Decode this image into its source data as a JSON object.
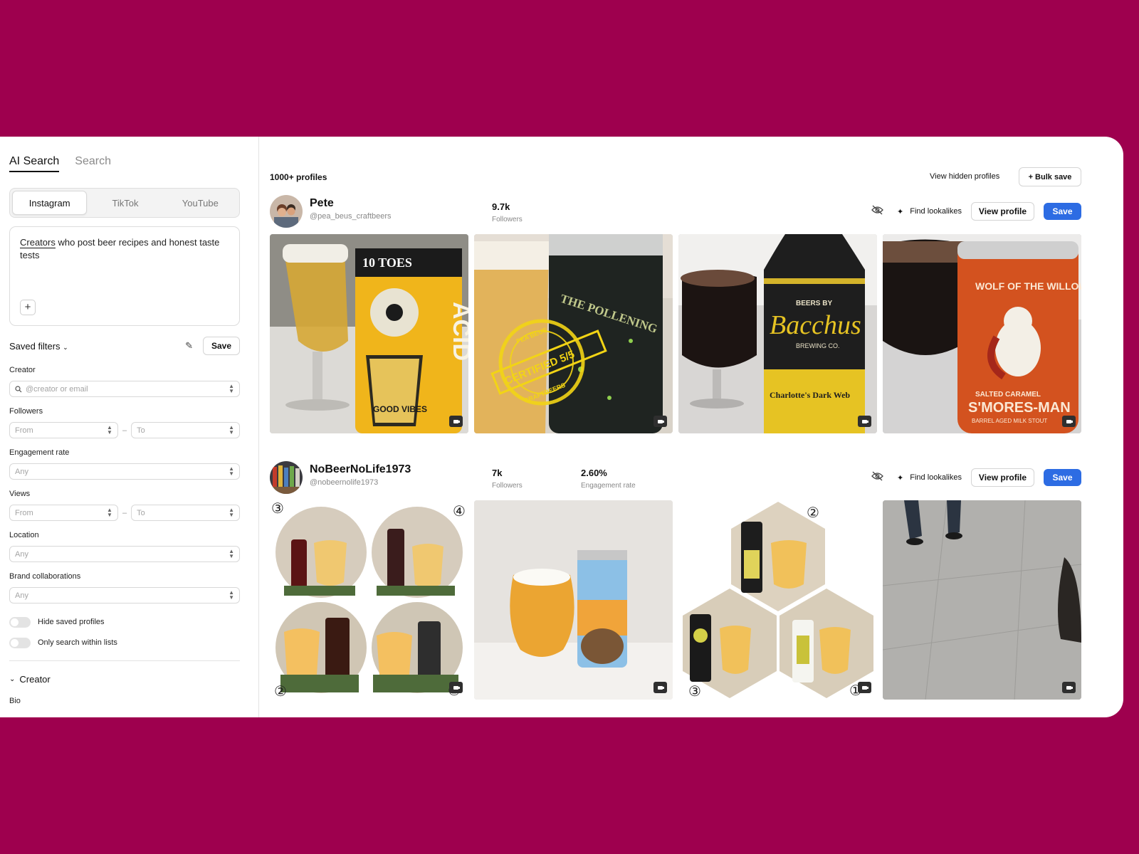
{
  "sidebar": {
    "tabs": [
      "AI Search",
      "Search"
    ],
    "platforms": [
      "Instagram",
      "TikTok",
      "YouTube"
    ],
    "prompt": {
      "underlined": "Creators",
      "rest": " who post beer recipes and honest taste tests"
    },
    "saved_filters": "Saved filters",
    "save": "Save",
    "creator_label": "Creator",
    "creator_placeholder": "@creator or email",
    "followers_label": "Followers",
    "from": "From",
    "to": "To",
    "engagement_label": "Engagement rate",
    "any": "Any",
    "views_label": "Views",
    "location_label": "Location",
    "brand_label": "Brand collaborations",
    "toggle_hide": "Hide saved profiles",
    "toggle_lists": "Only search within lists",
    "section_creator": "Creator",
    "bio": "Bio"
  },
  "results": {
    "count": "1000+ profiles",
    "view_hidden": "View hidden profiles",
    "bulk_save": "+ Bulk save",
    "find_lookalikes": "Find lookalikes",
    "view_profile": "View profile",
    "save": "Save",
    "followers_caption": "Followers",
    "engagement_caption": "Engagement rate",
    "profiles": [
      {
        "name": "Pete",
        "handle": "@pea_beus_craftbeers",
        "followers": "9.7k"
      },
      {
        "name": "NoBeerNoLife1973",
        "handle": "@nobeernolife1973",
        "followers": "7k",
        "engagement": "2.60%"
      }
    ]
  },
  "tiles": {
    "t1": {
      "brand": "10 TOES",
      "big": "ACID",
      "sub": "GOOD VIBES"
    },
    "t2": {
      "title": "THE POLLENING",
      "stamp": "CERTIFIED 5/5",
      "stamp_top": "PEA BEUS",
      "stamp_bottom": "CRAFTBEERS"
    },
    "t3": {
      "top": "BEERS BY",
      "brand": "Bacchus",
      "co": "BREWING CO.",
      "name": "Charlotte's Dark Web"
    },
    "t4": {
      "title": "WOLF OF THE WILLOWS",
      "name": "S'MORES-MAN",
      "top": "SALTED CARAMEL",
      "sub": "BARREL AGED MILK STOUT"
    },
    "n": [
      "③",
      "④",
      "②",
      "①"
    ],
    "n3": [
      "②",
      "③",
      "①"
    ]
  },
  "colors": {
    "bg": "#9e004e",
    "accent": "#2d6ce3"
  },
  "icons": [
    "search-icon",
    "pencil-icon",
    "chevron-down-icon",
    "eye-off-icon",
    "sparkle-icon",
    "video-icon",
    "plus-icon"
  ]
}
